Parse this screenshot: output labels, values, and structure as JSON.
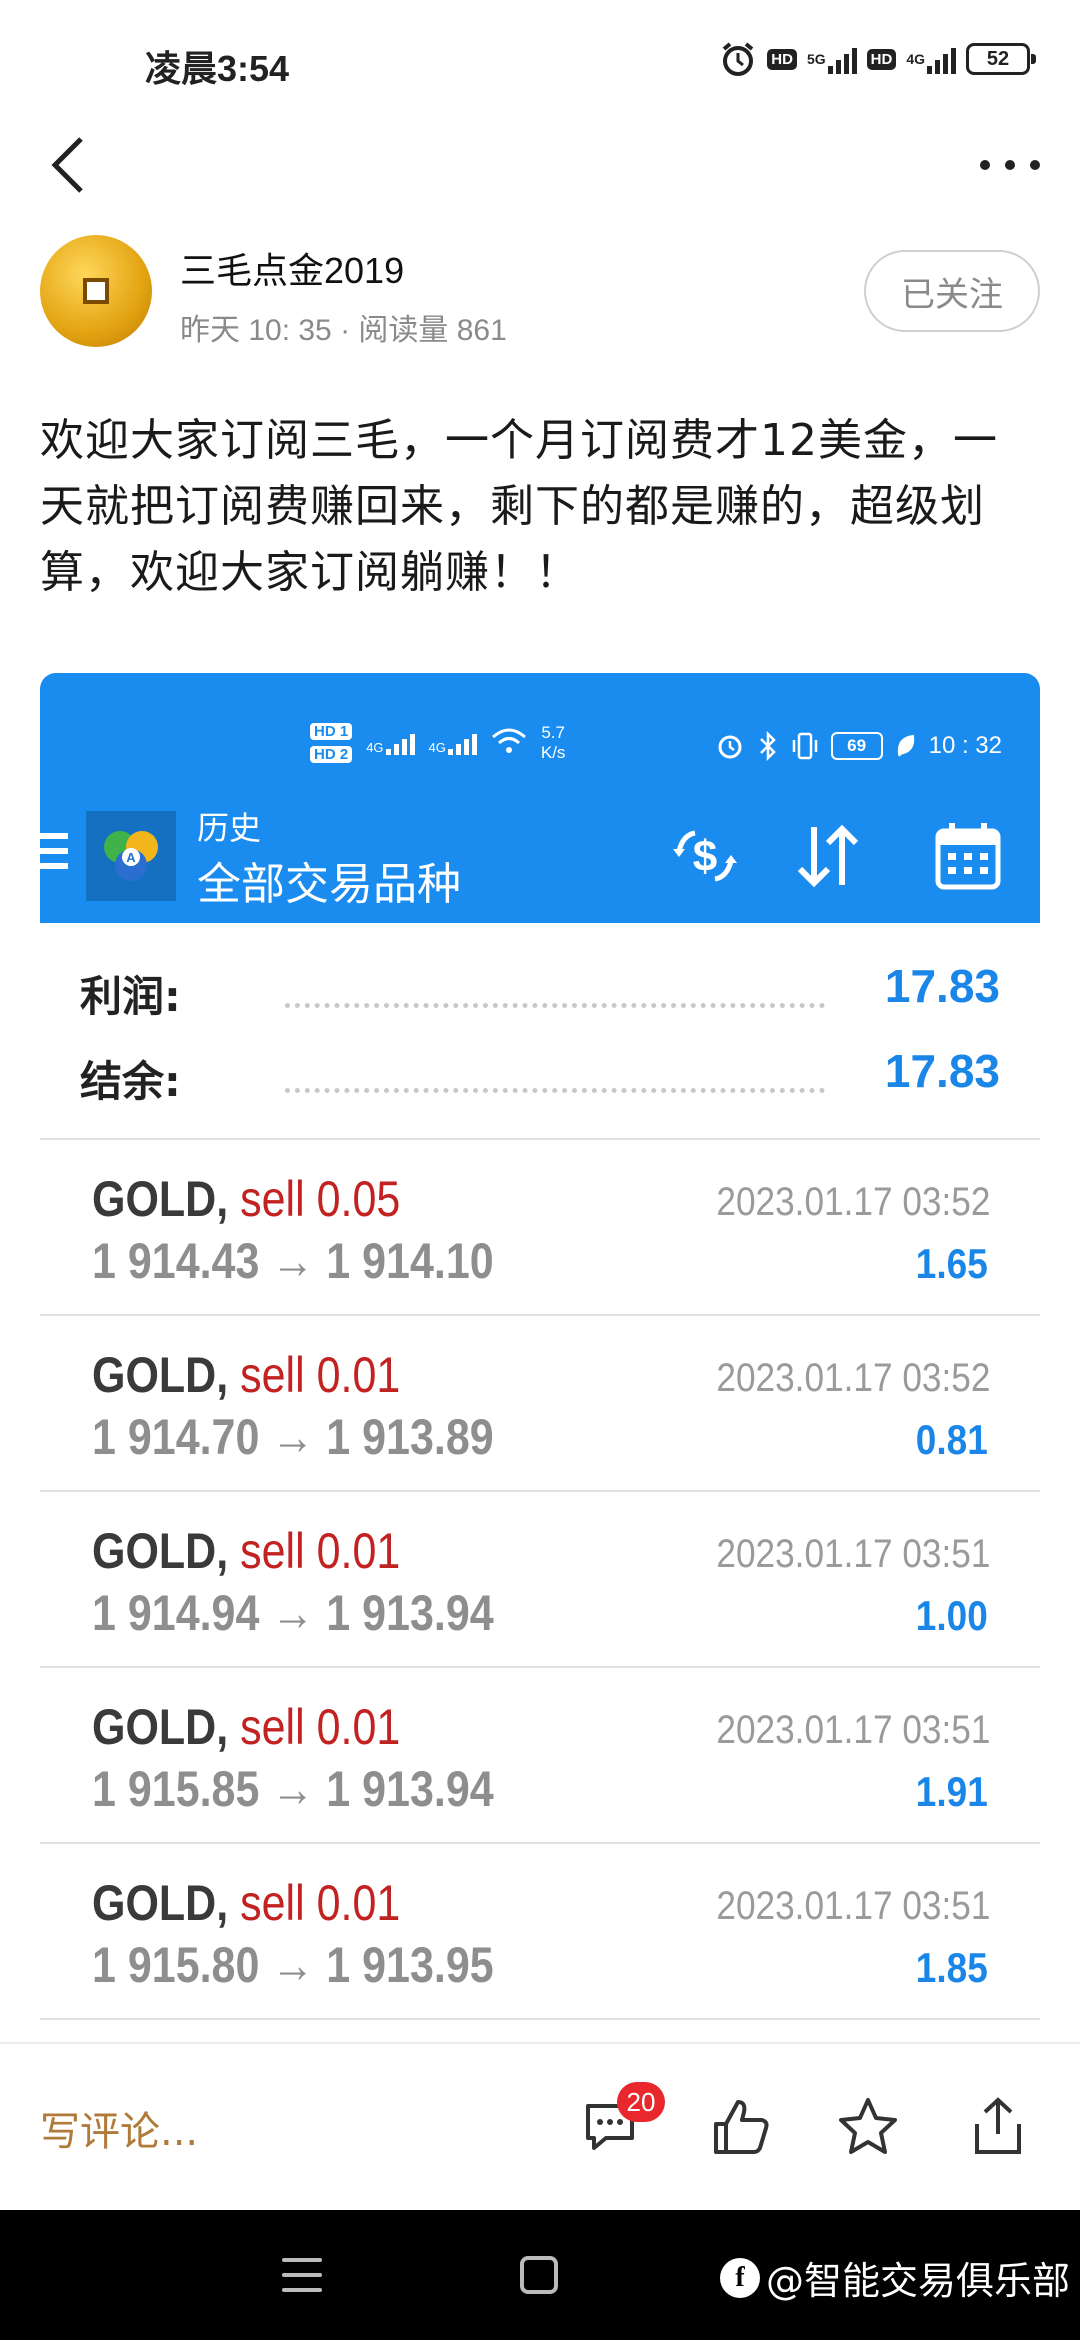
{
  "status_bar": {
    "time": "凌晨3:54",
    "hd1": "HD",
    "net1": "5G",
    "hd2": "HD",
    "net2": "4G",
    "battery": "52"
  },
  "author": {
    "name": "三毛点金2019",
    "meta": "昨天 10: 35 · 阅读量 861",
    "follow_label": "已关注"
  },
  "post": {
    "text": "欢迎大家订阅三毛，一个月订阅费才12美金，一天就把订阅费赚回来，剩下的都是赚的，超级划算，欢迎大家订阅躺赚！！"
  },
  "embedded": {
    "status": {
      "hd1": "HD 1",
      "hd2": "HD 2",
      "net1": "4G",
      "net2": "4G",
      "speed_value": "5.7",
      "speed_unit": "K/s",
      "battery": "69",
      "time": "10 : 32"
    },
    "header": {
      "subtitle": "历史",
      "title": "全部交易品种"
    },
    "summary": [
      {
        "label": "利润:",
        "value": "17.83"
      },
      {
        "label": "结余:",
        "value": "17.83"
      }
    ],
    "trades": [
      {
        "symbol": "GOLD,",
        "side": "sell 0.05",
        "prices": "1 914.43 → 1 914.10",
        "time": "2023.01.17 03:52",
        "profit": "1.65"
      },
      {
        "symbol": "GOLD,",
        "side": "sell 0.01",
        "prices": "1 914.70 → 1 913.89",
        "time": "2023.01.17 03:52",
        "profit": "0.81"
      },
      {
        "symbol": "GOLD,",
        "side": "sell 0.01",
        "prices": "1 914.94 → 1 913.94",
        "time": "2023.01.17 03:51",
        "profit": "1.00"
      },
      {
        "symbol": "GOLD,",
        "side": "sell 0.01",
        "prices": "1 915.85 → 1 913.94",
        "time": "2023.01.17 03:51",
        "profit": "1.91"
      },
      {
        "symbol": "GOLD,",
        "side": "sell 0.01",
        "prices": "1 915.80 → 1 913.95",
        "time": "2023.01.17 03:51",
        "profit": "1.85"
      }
    ]
  },
  "comment_bar": {
    "placeholder": "写评论...",
    "comment_count": "20"
  },
  "watermark": {
    "text": "@智能交易俱乐部"
  },
  "colors": {
    "mt_blue": "#1a8cf0",
    "profit_blue": "#1a86e8",
    "sell_red": "#c22222",
    "badge_red": "#e8282d"
  }
}
